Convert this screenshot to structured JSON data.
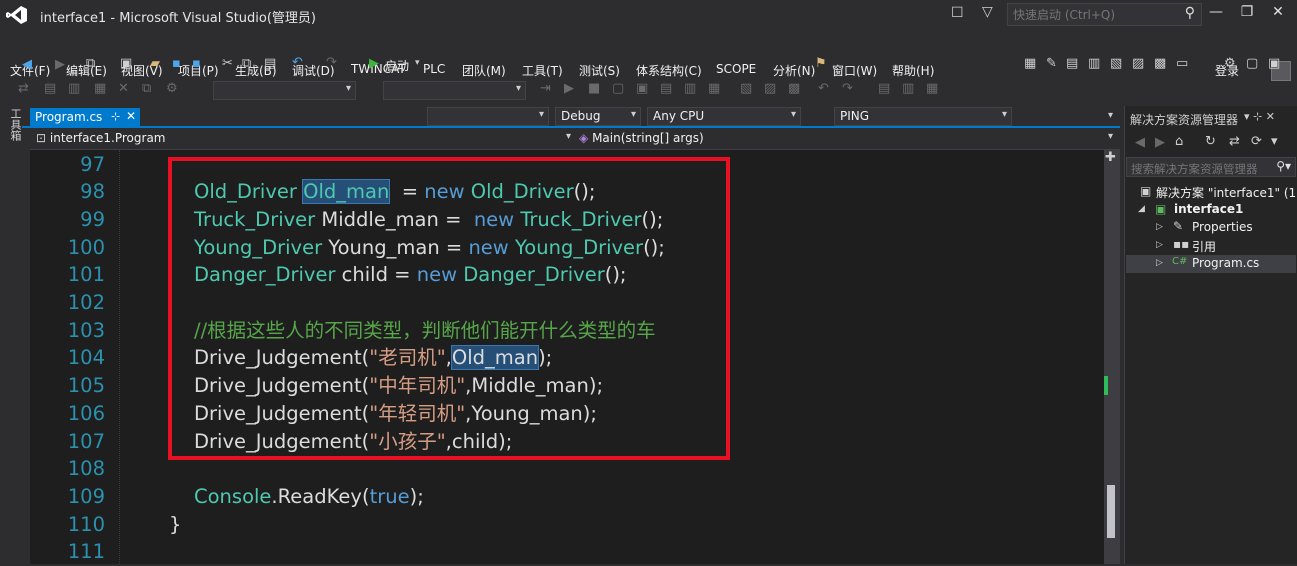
{
  "window": {
    "title": "interface1 - Microsoft Visual Studio(管理员)",
    "quick_launch_placeholder": "快速启动 (Ctrl+Q)",
    "login": "登录"
  },
  "menu": [
    "文件(F)",
    "编辑(E)",
    "视图(V)",
    "项目(P)",
    "生成(B)",
    "调试(D)",
    "TWINCAT",
    "PLC",
    "团队(M)",
    "工具(T)",
    "测试(S)",
    "体系结构(C)",
    "SCOPE",
    "分析(N)",
    "窗口(W)",
    "帮助(H)"
  ],
  "toolbar": {
    "start_label": "启动",
    "config": "Debug",
    "platform": "Any CPU",
    "target": "PING"
  },
  "side_tab": "工具箱",
  "tab": {
    "label": "Program.cs"
  },
  "nav": {
    "left": "interface1.Program",
    "right": "Main(string[] args)"
  },
  "code_lines": [
    {
      "num": "97"
    },
    {
      "num": "98",
      "tokens": [
        [
          "t",
          "Old_Driver"
        ],
        [
          "p",
          " "
        ],
        [
          "th",
          "Old_man"
        ],
        [
          "p",
          "  = "
        ],
        [
          "k",
          "new"
        ],
        [
          "p",
          " "
        ],
        [
          "t",
          "Old_Driver"
        ],
        [
          "p",
          "();"
        ]
      ]
    },
    {
      "num": "99",
      "tokens": [
        [
          "t",
          "Truck_Driver"
        ],
        [
          "p",
          " Middle_man =  "
        ],
        [
          "k",
          "new"
        ],
        [
          "p",
          " "
        ],
        [
          "t",
          "Truck_Driver"
        ],
        [
          "p",
          "();"
        ]
      ]
    },
    {
      "num": "100",
      "tokens": [
        [
          "t",
          "Young_Driver"
        ],
        [
          "p",
          " Young_man = "
        ],
        [
          "k",
          "new"
        ],
        [
          "p",
          " "
        ],
        [
          "t",
          "Young_Driver"
        ],
        [
          "p",
          "();"
        ]
      ]
    },
    {
      "num": "101",
      "tokens": [
        [
          "t",
          "Danger_Driver"
        ],
        [
          "p",
          " child = "
        ],
        [
          "k",
          "new"
        ],
        [
          "p",
          " "
        ],
        [
          "t",
          "Danger_Driver"
        ],
        [
          "p",
          "();"
        ]
      ]
    },
    {
      "num": "102"
    },
    {
      "num": "103",
      "tokens": [
        [
          "c",
          "//根据这些人的不同类型，判断他们能开什么类型的车"
        ]
      ]
    },
    {
      "num": "104",
      "tokens": [
        [
          "p",
          "Drive_Judgement("
        ],
        [
          "s",
          "\"老司机\""
        ],
        [
          "p",
          ","
        ],
        [
          "ph",
          "Old_man"
        ],
        [
          "p",
          ");"
        ]
      ]
    },
    {
      "num": "105",
      "tokens": [
        [
          "p",
          "Drive_Judgement("
        ],
        [
          "s",
          "\"中年司机\""
        ],
        [
          "p",
          ",Middle_man);"
        ]
      ]
    },
    {
      "num": "106",
      "tokens": [
        [
          "p",
          "Drive_Judgement("
        ],
        [
          "s",
          "\"年轻司机\""
        ],
        [
          "p",
          ",Young_man);"
        ]
      ]
    },
    {
      "num": "107",
      "tokens": [
        [
          "p",
          "Drive_Judgement("
        ],
        [
          "s",
          "\"小孩子\""
        ],
        [
          "p",
          ",child);"
        ]
      ]
    },
    {
      "num": "108"
    },
    {
      "num": "109",
      "tokens": [
        [
          "t",
          "Console"
        ],
        [
          "p",
          ".ReadKey("
        ],
        [
          "k",
          "true"
        ],
        [
          "p",
          ");"
        ]
      ]
    },
    {
      "num": "110",
      "tokens": [
        [
          "p",
          "}"
        ]
      ]
    },
    {
      "num": "111"
    }
  ],
  "solution_explorer": {
    "title": "解决方案资源管理器",
    "search_placeholder": "搜索解决方案资源管理器",
    "items": [
      {
        "label": "解决方案 \"interface1\" (1"
      },
      {
        "label": "interface1"
      },
      {
        "label": "Properties"
      },
      {
        "label": "引用"
      },
      {
        "label": "Program.cs"
      }
    ]
  },
  "colors": {
    "accent": "#007acc",
    "highlight_box": "#e81123",
    "type": "#4ec9b0",
    "keyword": "#569cd6",
    "comment": "#57a64a",
    "string": "#d69d85",
    "line_number": "#2b91af"
  }
}
